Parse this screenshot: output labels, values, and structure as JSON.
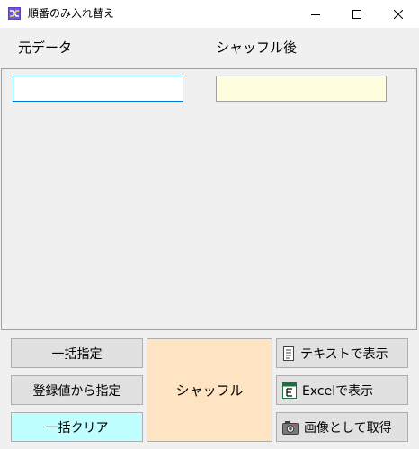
{
  "window": {
    "title": "順番のみ入れ替え",
    "controls": [
      "minimize-icon",
      "maximize-icon",
      "close-icon"
    ]
  },
  "columns": {
    "source_label": "元データ",
    "result_label": "シャッフル後"
  },
  "fields": {
    "source_value": "",
    "result_value": ""
  },
  "buttons": {
    "bulk_set": "一括指定",
    "set_from_registered": "登録値から指定",
    "bulk_clear": "一括クリア",
    "shuffle": "シャッフル",
    "show_as_text": "テキストで表示",
    "show_in_excel": "Excelで表示",
    "capture_image": "画像として取得"
  },
  "colors": {
    "clear_button": "#c0ffff",
    "shuffle_button": "#ffe4c4",
    "result_field": "#ffffe0",
    "focus_border": "#0078d7"
  },
  "icons": {
    "app": "shuffle-app-icon",
    "text": "document-icon",
    "excel": "excel-icon",
    "image": "camera-icon"
  }
}
